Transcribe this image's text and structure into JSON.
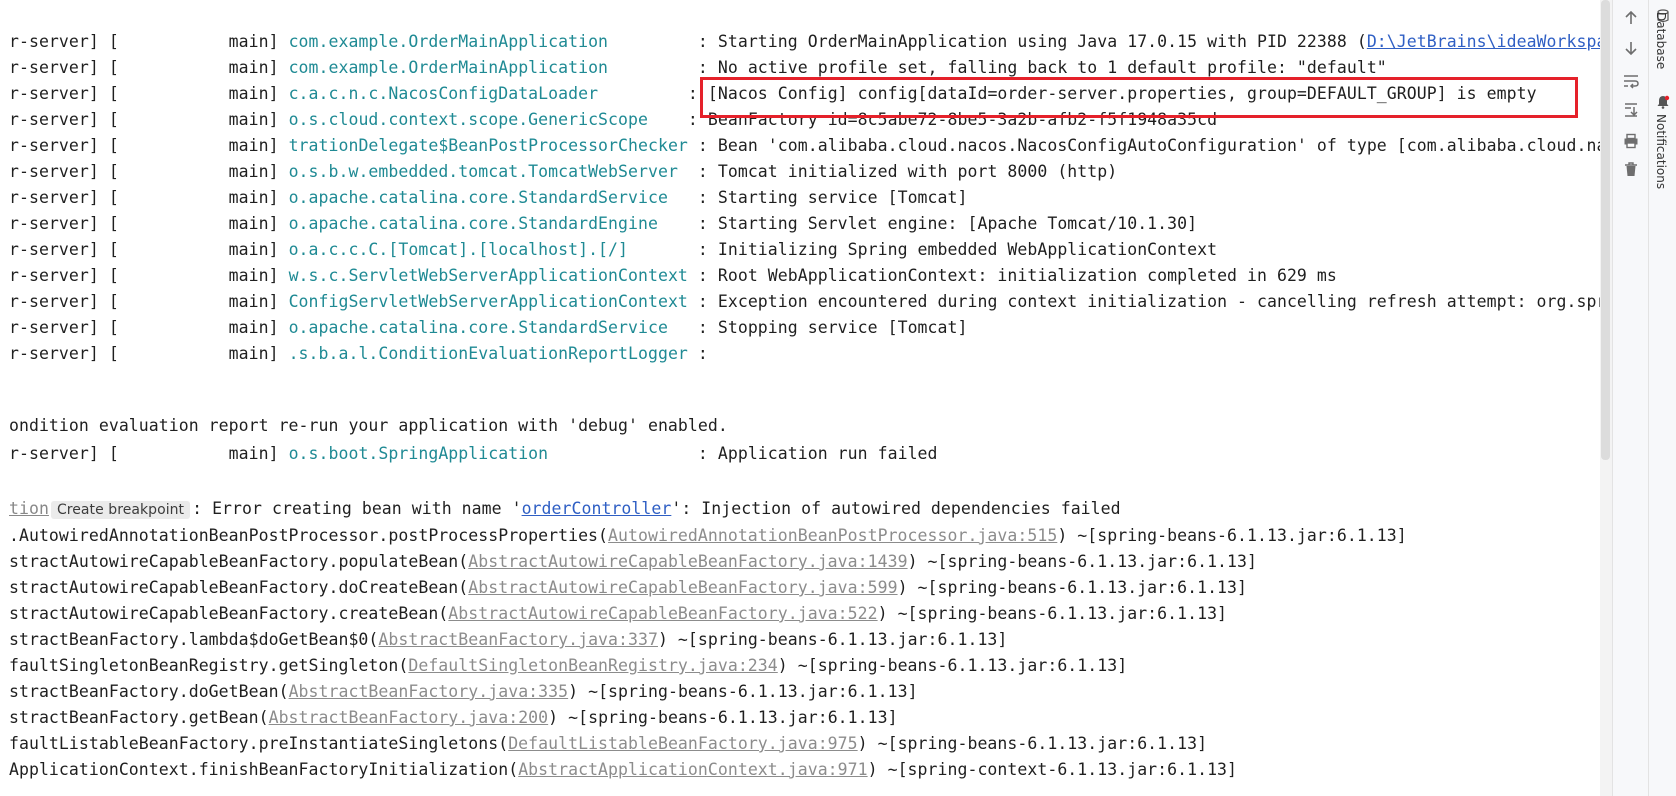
{
  "console": {
    "lines": [
      {
        "prefix": "r-server] [           main] ",
        "logger": "com.example.OrderMainApplication        ",
        "sep": " : ",
        "message": "Starting OrderMainApplication using Java 17.0.15 with PID 22388 (",
        "link": "D:\\JetBrains\\ideaWorkspac"
      },
      {
        "prefix": "r-server] [           main] ",
        "logger": "com.example.OrderMainApplication        ",
        "sep": " : ",
        "message": "No active profile set, falling back to 1 default profile: \"default\""
      },
      {
        "prefix": "r-server] [           main] ",
        "logger": "c.a.c.n.c.NacosConfigDataLoader        ",
        "sep": " : ",
        "message": "[Nacos Config] config[dataId=order-server.properties, group=DEFAULT_GROUP] is empty"
      },
      {
        "prefix": "r-server] [           main] ",
        "logger": "o.s.cloud.context.scope.GenericScope   ",
        "sep": " : ",
        "message": "BeanFactory id=8c5abe72-8be5-3a2b-afb2-f5f1948a35cd"
      },
      {
        "prefix": "r-server] [           main] ",
        "logger": "trationDelegate$BeanPostProcessorChecker",
        "sep": " : ",
        "message": "Bean 'com.alibaba.cloud.nacos.NacosConfigAutoConfiguration' of type [com.alibaba.cloud.nac"
      },
      {
        "prefix": "r-server] [           main] ",
        "logger": "o.s.b.w.embedded.tomcat.TomcatWebServer ",
        "sep": " : ",
        "message": "Tomcat initialized with port 8000 (http)"
      },
      {
        "prefix": "r-server] [           main] ",
        "logger": "o.apache.catalina.core.StandardService  ",
        "sep": " : ",
        "message": "Starting service [Tomcat]"
      },
      {
        "prefix": "r-server] [           main] ",
        "logger": "o.apache.catalina.core.StandardEngine   ",
        "sep": " : ",
        "message": "Starting Servlet engine: [Apache Tomcat/10.1.30]"
      },
      {
        "prefix": "r-server] [           main] ",
        "logger": "o.a.c.c.C.[Tomcat].[localhost].[/]      ",
        "sep": " : ",
        "message": "Initializing Spring embedded WebApplicationContext"
      },
      {
        "prefix": "r-server] [           main] ",
        "logger": "w.s.c.ServletWebServerApplicationContext",
        "sep": " : ",
        "message": "Root WebApplicationContext: initialization completed in 629 ms"
      },
      {
        "prefix": "r-server] [           main] ",
        "logger": "ConfigServletWebServerApplicationContext",
        "sep": " : ",
        "message": "Exception encountered during context initialization - cancelling refresh attempt: org.spri"
      },
      {
        "prefix": "r-server] [           main] ",
        "logger": "o.apache.catalina.core.StandardService  ",
        "sep": " : ",
        "message": "Stopping service [Tomcat]"
      },
      {
        "prefix": "r-server] [           main] ",
        "logger": ".s.b.a.l.ConditionEvaluationReportLogger",
        "sep": " :",
        "message": ""
      }
    ],
    "condition_line": "ondition evaluation report re-run your application with 'debug' enabled.",
    "failed_line": {
      "prefix": "r-server] [           main] ",
      "logger": "o.s.boot.SpringApplication              ",
      "sep": " : ",
      "message": "Application run failed"
    },
    "exception_line": {
      "muted": "tion",
      "chip": "Create breakpoint",
      "before": ": Error creating bean with name '",
      "link": "orderController",
      "after": "': Injection of autowired dependencies failed"
    },
    "stack": [
      {
        "method": ".AutowiredAnnotationBeanPostProcessor.postProcessProperties(",
        "source": "AutowiredAnnotationBeanPostProcessor.java:515",
        "jar": ") ~[spring-beans-6.1.13.jar:6.1.13]"
      },
      {
        "method": "stractAutowireCapableBeanFactory.populateBean(",
        "source": "AbstractAutowireCapableBeanFactory.java:1439",
        "jar": ") ~[spring-beans-6.1.13.jar:6.1.13]"
      },
      {
        "method": "stractAutowireCapableBeanFactory.doCreateBean(",
        "source": "AbstractAutowireCapableBeanFactory.java:599",
        "jar": ") ~[spring-beans-6.1.13.jar:6.1.13]"
      },
      {
        "method": "stractAutowireCapableBeanFactory.createBean(",
        "source": "AbstractAutowireCapableBeanFactory.java:522",
        "jar": ") ~[spring-beans-6.1.13.jar:6.1.13]"
      },
      {
        "method": "stractBeanFactory.lambda$doGetBean$0(",
        "source": "AbstractBeanFactory.java:337",
        "jar": ") ~[spring-beans-6.1.13.jar:6.1.13]"
      },
      {
        "method": "faultSingletonBeanRegistry.getSingleton(",
        "source": "DefaultSingletonBeanRegistry.java:234",
        "jar": ") ~[spring-beans-6.1.13.jar:6.1.13]"
      },
      {
        "method": "stractBeanFactory.doGetBean(",
        "source": "AbstractBeanFactory.java:335",
        "jar": ") ~[spring-beans-6.1.13.jar:6.1.13]"
      },
      {
        "method": "stractBeanFactory.getBean(",
        "source": "AbstractBeanFactory.java:200",
        "jar": ") ~[spring-beans-6.1.13.jar:6.1.13]"
      },
      {
        "method": "faultListableBeanFactory.preInstantiateSingletons(",
        "source": "DefaultListableBeanFactory.java:975",
        "jar": ") ~[spring-beans-6.1.13.jar:6.1.13]"
      },
      {
        "method": "ApplicationContext.finishBeanFactoryInitialization(",
        "source": "AbstractApplicationContext.java:971",
        "jar": ") ~[spring-context-6.1.13.jar:6.1.13]"
      }
    ]
  },
  "toolbar": {
    "icons": [
      "arrow-up-icon",
      "arrow-down-icon",
      "soft-wrap-icon",
      "scroll-to-end-icon",
      "print-icon",
      "trash-icon"
    ]
  },
  "side_strip": {
    "database_label": "Database",
    "notifications_label": "Notifications"
  },
  "colors": {
    "logger": "#1f8a94",
    "link": "#2f5fc4",
    "highlight_border": "#e5212a"
  }
}
